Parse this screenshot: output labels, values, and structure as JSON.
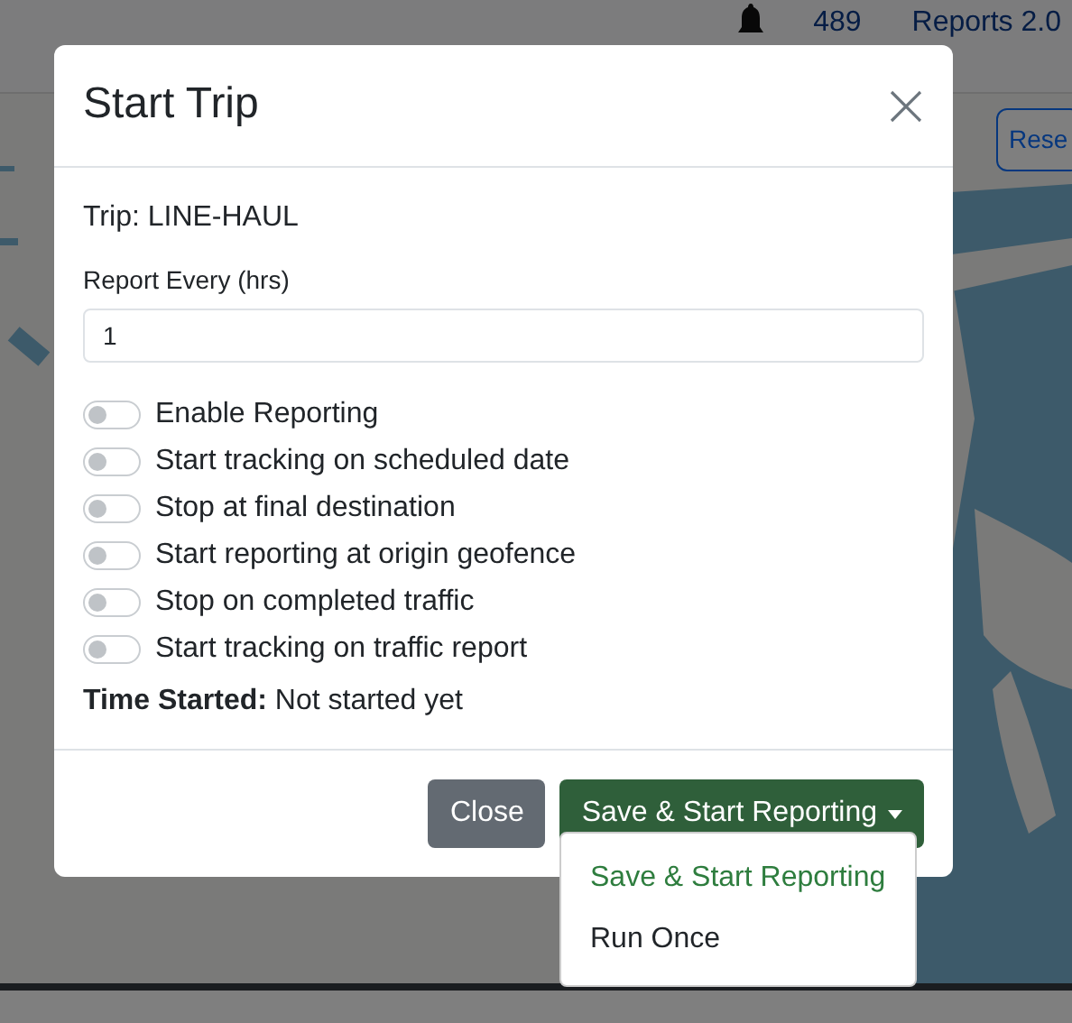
{
  "navbar": {
    "account": "489",
    "link": "Reports 2.0"
  },
  "map": {
    "kind": "picture",
    "reset_button": "Rese"
  },
  "modal": {
    "title": "Start Trip",
    "trip": "Trip: LINE-HAUL",
    "interval": {
      "label": "Report Every (hrs)",
      "value": "1"
    },
    "toggles": [
      {
        "label": "Enable Reporting",
        "checked": false
      },
      {
        "label": "Start tracking on scheduled date",
        "checked": false
      },
      {
        "label": "Stop at final destination",
        "checked": false
      },
      {
        "label": "Start reporting at origin geofence",
        "checked": false
      },
      {
        "label": "Stop on completed traffic",
        "checked": false
      },
      {
        "label": "Start tracking on traffic report",
        "checked": false
      }
    ],
    "time_started": "**Time Started:** Not started yet",
    "buttons": [
      {
        "label": "Close",
        "kind": "secondary"
      },
      {
        "label": "Save & Start Reporting",
        "kind": "split"
      }
    ],
    "menu": [
      {
        "label": "Save & Start Reporting",
        "selected": true
      },
      {
        "label": "Run Once",
        "selected": false
      }
    ]
  }
}
